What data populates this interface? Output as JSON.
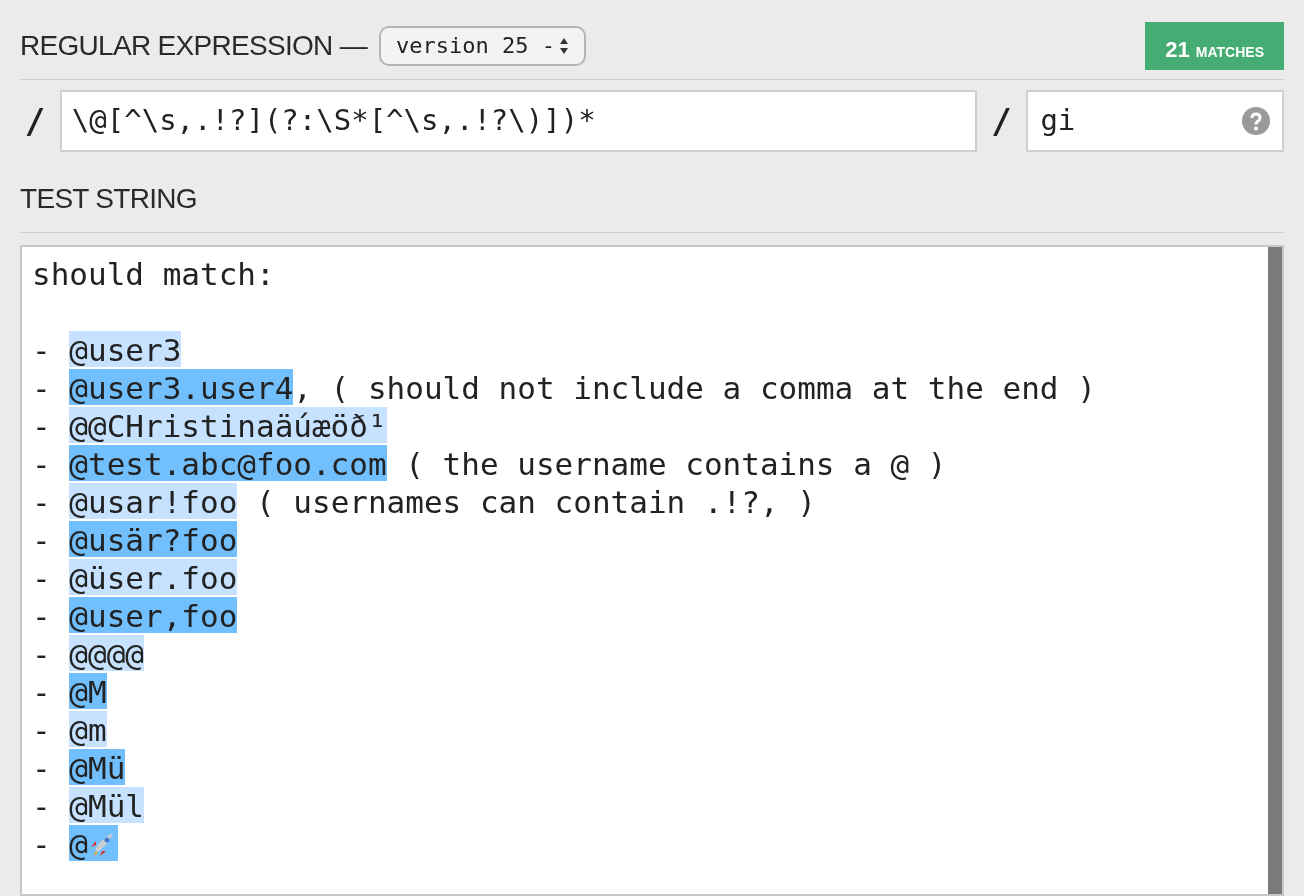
{
  "regex_section": {
    "title": "REGULAR EXPRESSION —",
    "version_select": "version 25 -",
    "match_count": "21",
    "match_label": "MATCHES"
  },
  "pattern": {
    "open_delimiter": "/",
    "value": "\\@[^\\s,.!?](?:\\S*[^\\s,.!?\\)])*",
    "close_delimiter": "/",
    "flags": "gi"
  },
  "test_section": {
    "title": "TEST STRING"
  },
  "test_lines": [
    {
      "segments": [
        {
          "text": "should match:"
        }
      ]
    },
    {
      "segments": [
        {
          "text": "- "
        },
        {
          "text": "@user3",
          "color": "#c6e2fe"
        }
      ]
    },
    {
      "segments": [
        {
          "text": "- "
        },
        {
          "text": "@user3.user4",
          "color": "#71bffd"
        },
        {
          "text": ", ( should not include a comma at the end )"
        }
      ]
    },
    {
      "segments": [
        {
          "text": "- "
        },
        {
          "text": "@@CHristinaäúæöð¹",
          "color": "#c6e2fe"
        }
      ]
    },
    {
      "segments": [
        {
          "text": "- "
        },
        {
          "text": "@test.abc@foo.com",
          "color": "#71bffd"
        },
        {
          "text": " ( the username contains a @ )"
        }
      ]
    },
    {
      "segments": [
        {
          "text": "- "
        },
        {
          "text": "@usar!foo",
          "color": "#c6e2fe"
        },
        {
          "text": " ( usernames can contain .!?, )"
        }
      ]
    },
    {
      "segments": [
        {
          "text": "- "
        },
        {
          "text": "@usär?foo",
          "color": "#71bffd"
        }
      ]
    },
    {
      "segments": [
        {
          "text": "- "
        },
        {
          "text": "@üser.foo",
          "color": "#c6e2fe"
        }
      ]
    },
    {
      "segments": [
        {
          "text": "- "
        },
        {
          "text": "@user,foo",
          "color": "#71bffd"
        }
      ]
    },
    {
      "segments": [
        {
          "text": "- "
        },
        {
          "text": "@@@@",
          "color": "#c6e2fe"
        }
      ]
    },
    {
      "segments": [
        {
          "text": "- "
        },
        {
          "text": "@M",
          "color": "#71bffd"
        }
      ]
    },
    {
      "segments": [
        {
          "text": "- "
        },
        {
          "text": "@m",
          "color": "#c6e2fe"
        }
      ]
    },
    {
      "segments": [
        {
          "text": "- "
        },
        {
          "text": "@Mü",
          "color": "#71bffd"
        }
      ]
    },
    {
      "segments": [
        {
          "text": "- "
        },
        {
          "text": "@Mül",
          "color": "#c6e2fe"
        }
      ]
    },
    {
      "segments": [
        {
          "text": "- "
        },
        {
          "text": "@",
          "color": "#71bffd",
          "kind": "icon"
        }
      ]
    }
  ]
}
